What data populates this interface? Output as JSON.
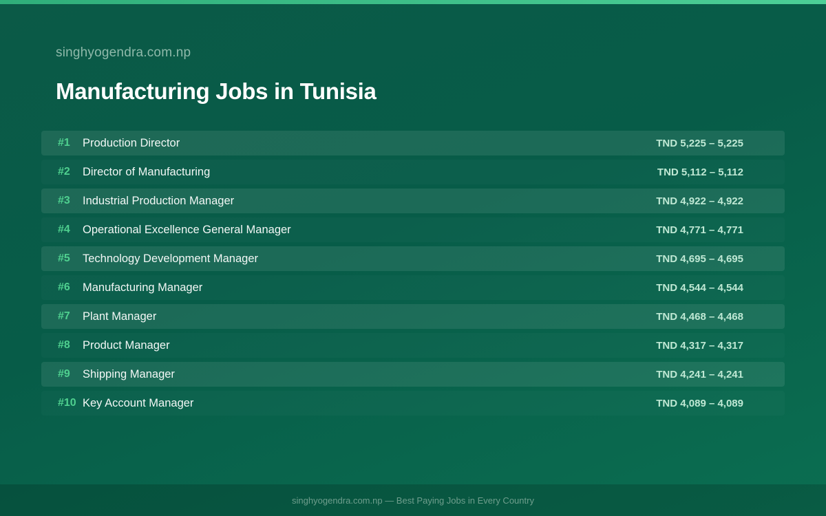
{
  "header": {
    "site": "singhyogendra.com.np",
    "title": "Manufacturing Jobs in Tunisia"
  },
  "jobs": [
    {
      "rank": "#1",
      "title": "Production Director",
      "salary": "TND 5,225 – 5,225"
    },
    {
      "rank": "#2",
      "title": "Director of Manufacturing",
      "salary": "TND 5,112 – 5,112"
    },
    {
      "rank": "#3",
      "title": "Industrial Production Manager",
      "salary": "TND 4,922 – 4,922"
    },
    {
      "rank": "#4",
      "title": "Operational Excellence General Manager",
      "salary": "TND 4,771 – 4,771"
    },
    {
      "rank": "#5",
      "title": "Technology Development Manager",
      "salary": "TND 4,695 – 4,695"
    },
    {
      "rank": "#6",
      "title": "Manufacturing Manager",
      "salary": "TND 4,544 – 4,544"
    },
    {
      "rank": "#7",
      "title": "Plant Manager",
      "salary": "TND 4,468 – 4,468"
    },
    {
      "rank": "#8",
      "title": "Product Manager",
      "salary": "TND 4,317 – 4,317"
    },
    {
      "rank": "#9",
      "title": "Shipping Manager",
      "salary": "TND 4,241 – 4,241"
    },
    {
      "rank": "#10",
      "title": "Key Account Manager",
      "salary": "TND 4,089 – 4,089"
    }
  ],
  "footer": {
    "text": "singhyogendra.com.np — Best Paying Jobs in Every Country"
  },
  "colors": {
    "accent": "#4fd08f",
    "background": "#075c48",
    "salary_text": "#bfe8d4"
  }
}
